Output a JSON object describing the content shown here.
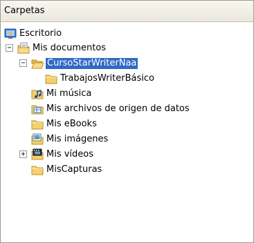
{
  "header": {
    "title": "Carpetas"
  },
  "tree": {
    "escritorio": {
      "label": "Escritorio",
      "icon": "desktop-icon"
    },
    "mis_documentos": {
      "label": "Mis documentos",
      "icon": "my-documents-icon",
      "expander": "−"
    },
    "curso": {
      "label": "CursoStarWriterNaa",
      "icon": "open-folder-icon",
      "expander": "−",
      "selected": true
    },
    "trabajos": {
      "label": "TrabajosWriterBásico",
      "icon": "folder-icon"
    },
    "musica": {
      "label": "Mi música",
      "icon": "my-music-icon"
    },
    "archivos": {
      "label": "Mis archivos de origen de datos",
      "icon": "data-sources-icon"
    },
    "ebooks": {
      "label": "Mis eBooks",
      "icon": "folder-icon"
    },
    "imagenes": {
      "label": "Mis imágenes",
      "icon": "my-pictures-icon"
    },
    "videos": {
      "label": "Mis vídeos",
      "icon": "my-videos-icon",
      "expander": "+"
    },
    "capturas": {
      "label": "MisCapturas",
      "icon": "folder-icon"
    }
  },
  "colors": {
    "selection": "#316ac5",
    "folder": "#f5d16a"
  }
}
